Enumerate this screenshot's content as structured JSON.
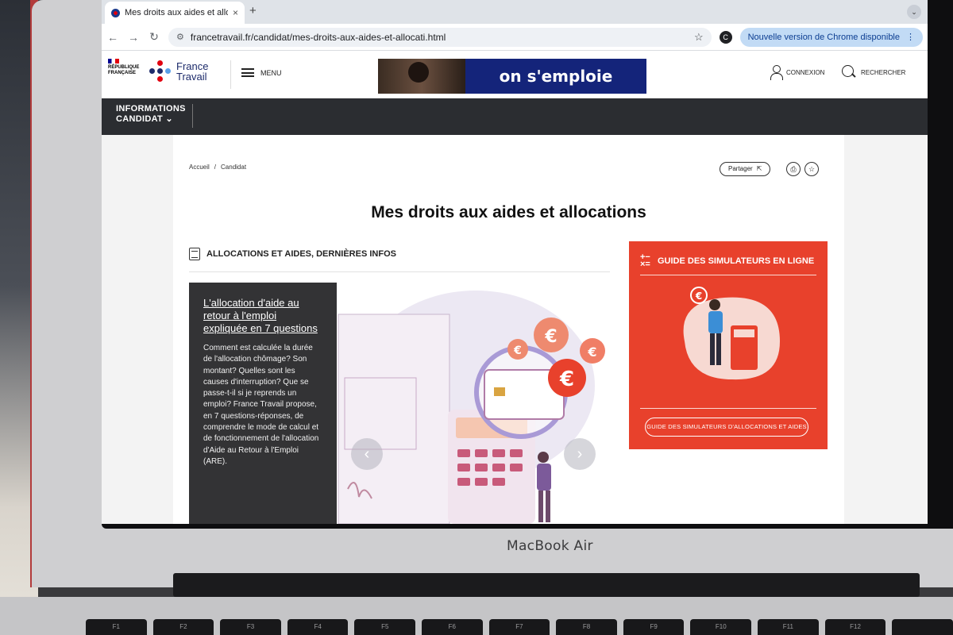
{
  "browser": {
    "tab_title": "Mes droits aux aides et alloca",
    "tab_close": "×",
    "new_tab": "+",
    "url": "francetravail.fr/candidat/mes-droits-aux-aides-et-allocati.html",
    "profile_initial": "C",
    "update_label": "Nouvelle version de Chrome disponible"
  },
  "site": {
    "gov_label": "RÉPUBLIQUE FRANÇAISE",
    "logo_line1": "France",
    "logo_line2": "Travail",
    "menu_label": "MENU",
    "banner_text": "on s'emploie",
    "login_label": "CONNEXION",
    "search_label": "RECHERCHER",
    "subnav_line1": "INFORMATIONS",
    "subnav_line2": "CANDIDAT"
  },
  "breadcrumb": [
    "Accueil",
    "/",
    "Candidat"
  ],
  "share_label": "Partager",
  "page_title": "Mes droits aux aides et allocations",
  "news": {
    "heading": "ALLOCATIONS ET AIDES, DERNIÈRES INFOS",
    "card_title": "L'allocation d'aide au retour à l'emploi expliquée en 7 questions",
    "card_text": "Comment est calculée la durée de l'allocation chômage? Son montant? Quelles sont les causes d'interruption? Que se passe-t-il si je reprends un emploi? France Travail propose, en 7 questions-réponses, de comprendre le mode de calcul et de fonctionnement de l'allocation d'Aide au Retour à l'Emploi (ARE)."
  },
  "simulators": {
    "heading": "GUIDE DES SIMULATEURS EN LIGNE",
    "button_label": "GUIDE DES SIMULATEURS D'ALLOCATIONS ET AIDES"
  },
  "device": {
    "brand": "MacBook Air",
    "keys": [
      "F1",
      "F2",
      "F3",
      "F4",
      "F5",
      "F6",
      "F7",
      "F8",
      "F9",
      "F10",
      "F11",
      "F12",
      ""
    ]
  },
  "colors": {
    "accent_red": "#e8412c",
    "navy": "#14247a",
    "dark_card": "#333335"
  }
}
